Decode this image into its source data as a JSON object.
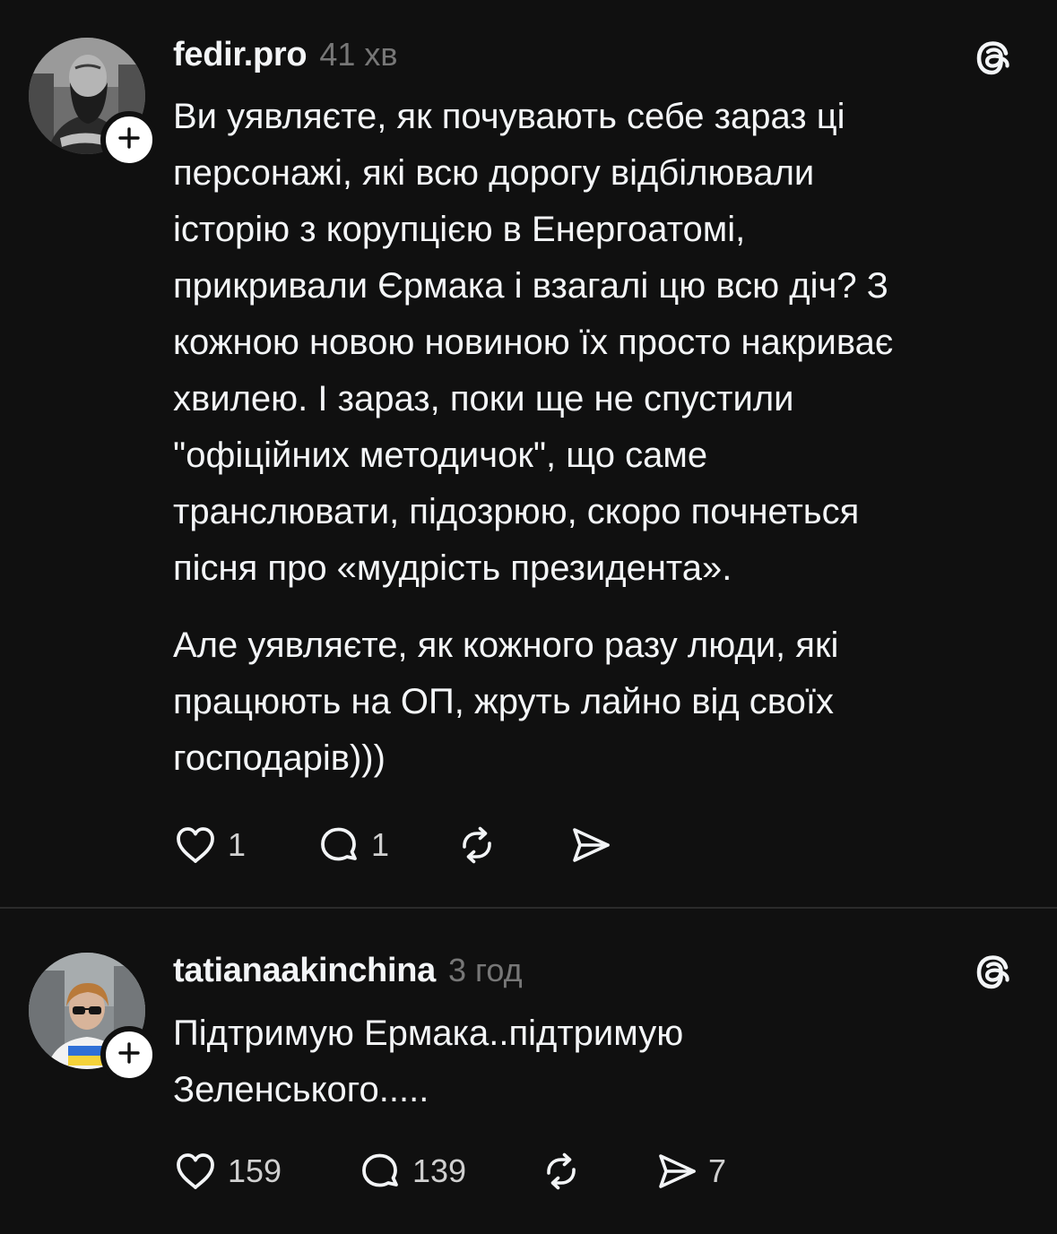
{
  "posts": [
    {
      "username": "fedir.pro",
      "timestamp": "41 хв",
      "avatar_icon": "user-avatar-photo",
      "follow_icon": "plus-icon",
      "app_icon": "threads-logo-icon",
      "paragraphs": [
        "Ви уявляєте, як почувають себе зараз ці\nперсонажі, які всю дорогу відбілювали\nісторію з корупцією в Енергоатомі,\nприкривали Єрмака і взагалі цю всю діч? З\nкожною новою новиною їх просто накриває\nхвилею. І зараз, поки ще не спустили\n\"офіційних методичок\", що саме\nтранслювати, підозрюю, скоро почнеться\nпісня про «мудрість президента».",
        "Але уявляєте, як кожного разу люди, які\nпрацюють на ОП, жруть лайно від своїх\nгосподарів)))"
      ],
      "actions": {
        "likes": "1",
        "replies": "1",
        "reposts": "",
        "shares": ""
      }
    },
    {
      "username": "tatianaakinchina",
      "timestamp": "3 год",
      "avatar_icon": "user-avatar-photo",
      "follow_icon": "plus-icon",
      "app_icon": "threads-logo-icon",
      "paragraphs": [
        "Підтримую Ермака..підтримую\nЗеленського....."
      ],
      "actions": {
        "likes": "159",
        "replies": "139",
        "reposts": "",
        "shares": "7"
      }
    }
  ],
  "colors": {
    "background": "#101010",
    "text": "#f3f5f7",
    "secondary": "#777777",
    "divider": "#2b2b2b"
  }
}
